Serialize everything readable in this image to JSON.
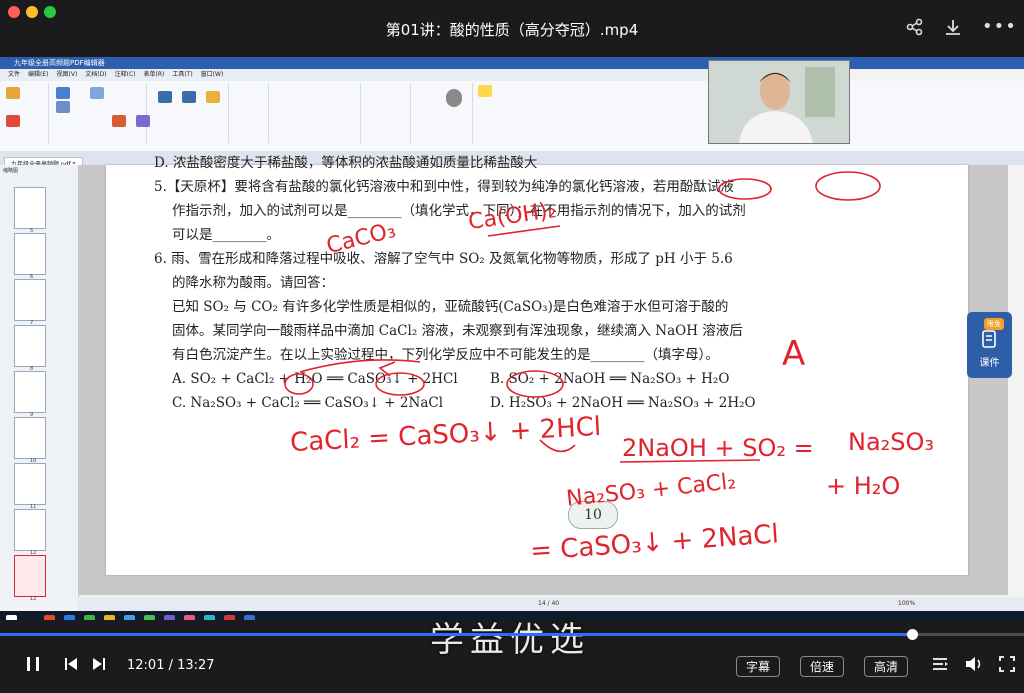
{
  "window": {
    "title": "第01讲：酸的性质（高分夺冠）.mp4",
    "traffic_colors": [
      "#ff5f57",
      "#febc2e",
      "#28c840"
    ]
  },
  "app": {
    "title": "九年级全册高频题PDF编辑器",
    "menu": [
      "文件",
      "编辑(E)",
      "视图(V)",
      "文档(D)",
      "注释(C)",
      "表单(R)",
      "工具(T)",
      "窗口(W)"
    ],
    "doc_tab": "九年级全册高频题.pdf *",
    "sidebar_title": "缩略图",
    "thumb_numbers": [
      "5",
      "6",
      "7",
      "8",
      "9",
      "10",
      "11",
      "12",
      "12"
    ],
    "page_indicator": "14 / 40",
    "zoom": "100%"
  },
  "document": {
    "line0": "D. 浓盐酸密度大于稀盐酸，等体积的浓盐酸通如质量比稀盐酸大",
    "q5_line1": "5.【天原杯】要将含有盐酸的氯化钙溶液中和到中性，得到较为纯净的氯化钙溶液，若用酚酞试液",
    "q5_line2": "作指示剂，加入的试剂可以是________（填化学式，下同）；在不用指示剂的情况下，加入的试剂",
    "q5_line3": "可以是________。",
    "q6_line1": "6. 雨、雪在形成和降落过程中吸收、溶解了空气中 SO₂ 及氮氧化物等物质，形成了 pH 小于 5.6",
    "q6_line2": "的降水称为酸雨。请回答：",
    "q6_line3": "已知 SO₂ 与 CO₂ 有许多化学性质是相似的，亚硫酸钙(CaSO₃)是白色难溶于水但可溶于酸的",
    "q6_line4": "固体。某同学向一酸雨样品中滴加 CaCl₂ 溶液，未观察到有浑浊现象，继续滴入 NaOH 溶液后",
    "q6_line5": "有白色沉淀产生。在以上实验过程中，下列化学反应中不可能发生的是________（填字母）。",
    "opt_a": "A. SO₂ + CaCl₂ + H₂O ══ CaSO₃↓ + 2HCl",
    "opt_b": "B. SO₂ + 2NaOH ══ Na₂SO₃ + H₂O",
    "opt_c": "C. Na₂SO₃ + CaCl₂ ══ CaSO₃↓ + 2NaCl",
    "opt_d": "D. H₂SO₃ + 2NaOH ══ Na₂SO₃ + 2H₂O",
    "page_badge": "10"
  },
  "handwriting": {
    "ans1": "Ca(OH)₂",
    "ans2": "CaCO₃",
    "ans3": "A",
    "eq1": "CaCl₂ = CaSO₃↓ + 2HCl",
    "eq2a": "2NaOH + SO₂ =",
    "eq2b": "Na₂SO₃",
    "eq2c": "+ H₂O",
    "eq3": "Na₂SO₃ + CaCl₂",
    "eq4": "= CaSO₃↓ + 2NaCl",
    "color": "#e0232c"
  },
  "side_panel": {
    "badge": "限免",
    "label": "课件"
  },
  "watermark": "学益优选",
  "player": {
    "time": "12:01 / 13:27",
    "progress_fraction": 0.891,
    "subtitle_btn": "字幕",
    "speed_btn": "倍速",
    "quality_btn": "高清",
    "accent": "#2f6bff"
  }
}
